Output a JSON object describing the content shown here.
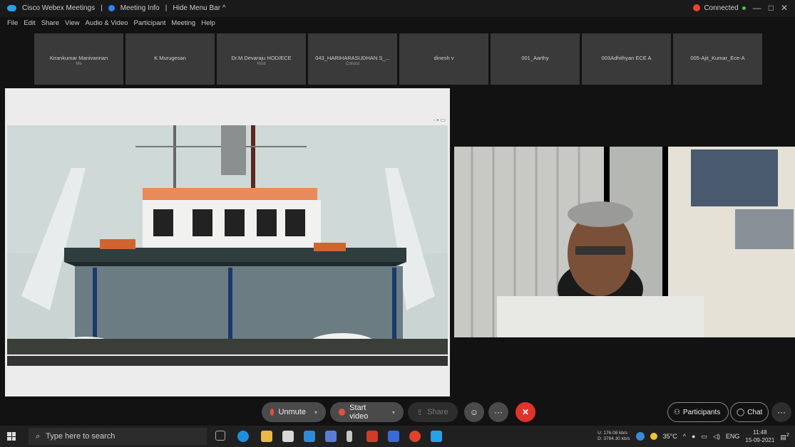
{
  "titlebar": {
    "app_name": "Cisco Webex Meetings",
    "meeting_info": "Meeting Info",
    "hide_menu": "Hide Menu Bar ^",
    "status": "Connected",
    "minimize": "—",
    "maximize": "□",
    "close": "✕"
  },
  "menu": [
    "File",
    "Edit",
    "Share",
    "View",
    "Audio & Video",
    "Participant",
    "Meeting",
    "Help"
  ],
  "participants": [
    {
      "name": "Kirankumar Manivannan",
      "sub": "Me"
    },
    {
      "name": "K Murugesan",
      "sub": ""
    },
    {
      "name": "Dr.M.Devaraju HOD/ECE",
      "sub": "Host"
    },
    {
      "name": "043_HARIHARASUDHAN S_...",
      "sub": "Cohost"
    },
    {
      "name": "dinesh v",
      "sub": ""
    },
    {
      "name": "001_Aarthy",
      "sub": ""
    },
    {
      "name": "003Adhithyan ECE A",
      "sub": ""
    },
    {
      "name": "005-Ajit_Kumar_Ece-A",
      "sub": ""
    }
  ],
  "toolbar": {
    "unmute": "Unmute",
    "start_video": "Start video",
    "share": "Share",
    "participants": "Participants",
    "chat": "Chat",
    "more": "···",
    "end": "✕"
  },
  "taskbar": {
    "search_placeholder": "Type here to search",
    "net_up": "U: 176.08 kb/s",
    "net_down": "D: 3784.30 kb/s",
    "temperature": "35°C",
    "language": "ENG",
    "time": "11:48",
    "date": "15-09-2021",
    "notifications": "2"
  }
}
